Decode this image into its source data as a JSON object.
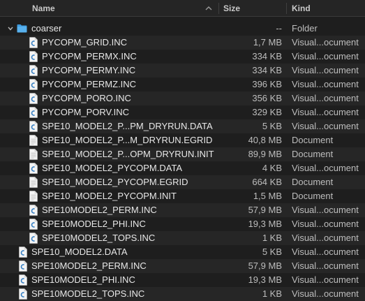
{
  "columns": {
    "name": "Name",
    "size": "Size",
    "kind": "Kind"
  },
  "folder": {
    "name": "coarser",
    "size": "--",
    "kind": "Folder"
  },
  "children": [
    {
      "name": "PYCOPM_GRID.INC",
      "size": "1,7 MB",
      "kind": "Visual...ocument",
      "icon": "vscode-doc-icon"
    },
    {
      "name": "PYCOPM_PERMX.INC",
      "size": "334 KB",
      "kind": "Visual...ocument",
      "icon": "vscode-doc-icon"
    },
    {
      "name": "PYCOPM_PERMY.INC",
      "size": "334 KB",
      "kind": "Visual...ocument",
      "icon": "vscode-doc-icon"
    },
    {
      "name": "PYCOPM_PERMZ.INC",
      "size": "396 KB",
      "kind": "Visual...ocument",
      "icon": "vscode-doc-icon"
    },
    {
      "name": "PYCOPM_PORO.INC",
      "size": "356 KB",
      "kind": "Visual...ocument",
      "icon": "vscode-doc-icon"
    },
    {
      "name": "PYCOPM_PORV.INC",
      "size": "329 KB",
      "kind": "Visual...ocument",
      "icon": "vscode-doc-icon"
    },
    {
      "name": "SPE10_MODEL2_P...PM_DRYRUN.DATA",
      "size": "5 KB",
      "kind": "Visual...ocument",
      "icon": "vscode-doc-icon"
    },
    {
      "name": "SPE10_MODEL2_P...M_DRYRUN.EGRID",
      "size": "40,8 MB",
      "kind": "Document",
      "icon": "plain-doc-icon"
    },
    {
      "name": "SPE10_MODEL2_P...OPM_DRYRUN.INIT",
      "size": "89,9 MB",
      "kind": "Document",
      "icon": "plain-doc-icon"
    },
    {
      "name": "SPE10_MODEL2_PYCOPM.DATA",
      "size": "4 KB",
      "kind": "Visual...ocument",
      "icon": "vscode-doc-icon"
    },
    {
      "name": "SPE10_MODEL2_PYCOPM.EGRID",
      "size": "664 KB",
      "kind": "Document",
      "icon": "plain-doc-icon"
    },
    {
      "name": "SPE10_MODEL2_PYCOPM.INIT",
      "size": "1,5 MB",
      "kind": "Document",
      "icon": "plain-doc-icon"
    },
    {
      "name": "SPE10MODEL2_PERM.INC",
      "size": "57,9 MB",
      "kind": "Visual...ocument",
      "icon": "vscode-doc-icon"
    },
    {
      "name": "SPE10MODEL2_PHI.INC",
      "size": "19,3 MB",
      "kind": "Visual...ocument",
      "icon": "vscode-doc-icon"
    },
    {
      "name": "SPE10MODEL2_TOPS.INC",
      "size": "1 KB",
      "kind": "Visual...ocument",
      "icon": "vscode-doc-icon"
    }
  ],
  "files": [
    {
      "name": "SPE10_MODEL2.DATA",
      "size": "5 KB",
      "kind": "Visual...ocument",
      "icon": "vscode-doc-icon"
    },
    {
      "name": "SPE10MODEL2_PERM.INC",
      "size": "57,9 MB",
      "kind": "Visual...ocument",
      "icon": "vscode-doc-icon"
    },
    {
      "name": "SPE10MODEL2_PHI.INC",
      "size": "19,3 MB",
      "kind": "Visual...ocument",
      "icon": "vscode-doc-icon"
    },
    {
      "name": "SPE10MODEL2_TOPS.INC",
      "size": "1 KB",
      "kind": "Visual...ocument",
      "icon": "vscode-doc-icon"
    }
  ],
  "colors": {
    "background": "#1e1e1e",
    "row_alt": "#262626",
    "folder": "#3e9ce0",
    "vscode_accent": "#3b82c4"
  }
}
